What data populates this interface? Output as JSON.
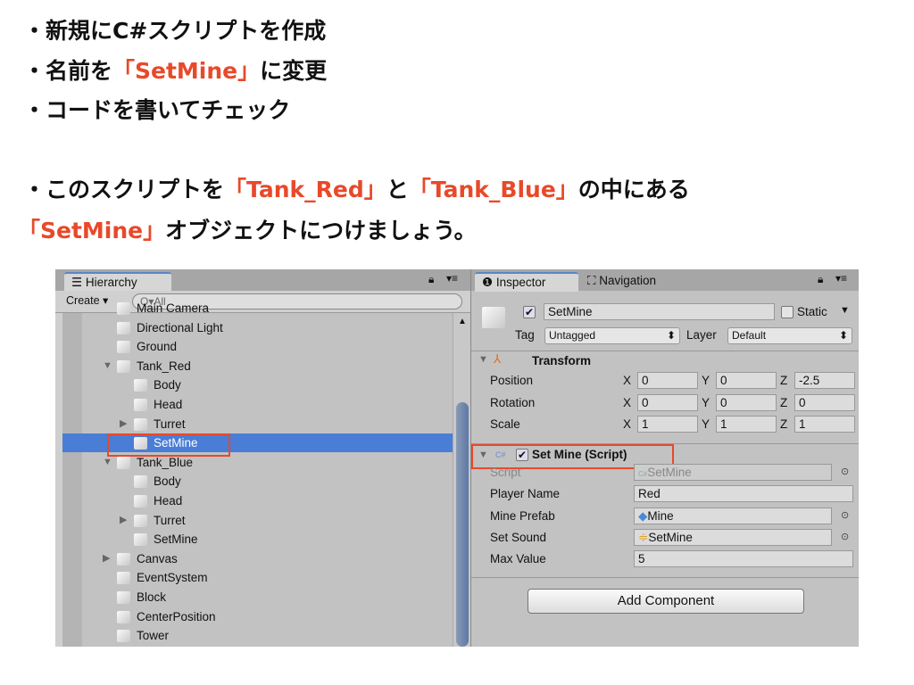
{
  "slide": {
    "line1": "・新規にC#スクリプトを作成",
    "line2_pre": "・名前を",
    "line2_hl": "「SetMine」",
    "line2_post": "に変更",
    "line3": "・コードを書いてチェック",
    "line4_pre": "・このスクリプトを",
    "line4_hl1": "「Tank_Red」",
    "line4_mid": "と",
    "line4_hl2": "「Tank_Blue」",
    "line4_post": "の中にある",
    "line5_hl": "「SetMine」",
    "line5_post": "オブジェクトにつけましょう。",
    "accent_color": "#e8492a"
  },
  "hierarchy": {
    "tab": "Hierarchy",
    "create": "Create ▾",
    "search_placeholder": "Q▾All",
    "items": [
      {
        "label": "Main Camera",
        "level": 0
      },
      {
        "label": "Directional Light",
        "level": 0
      },
      {
        "label": "Ground",
        "level": 0
      },
      {
        "label": "Tank_Red",
        "level": 0,
        "expanded": true
      },
      {
        "label": "Body",
        "level": 1
      },
      {
        "label": "Head",
        "level": 1
      },
      {
        "label": "Turret",
        "level": 1,
        "collapsed": true
      },
      {
        "label": "SetMine",
        "level": 1,
        "selected": true
      },
      {
        "label": "Tank_Blue",
        "level": 0,
        "expanded": true
      },
      {
        "label": "Body",
        "level": 1
      },
      {
        "label": "Head",
        "level": 1
      },
      {
        "label": "Turret",
        "level": 1,
        "collapsed": true
      },
      {
        "label": "SetMine",
        "level": 1
      },
      {
        "label": "Canvas",
        "level": 0,
        "collapsed": true
      },
      {
        "label": "EventSystem",
        "level": 0
      },
      {
        "label": "Block",
        "level": 0
      },
      {
        "label": "CenterPosition",
        "level": 0
      },
      {
        "label": "Tower",
        "level": 0
      }
    ]
  },
  "inspector": {
    "tab": "Inspector",
    "tab2": "Navigation",
    "name": "SetMine",
    "static": "Static",
    "tag_label": "Tag",
    "tag": "Untagged",
    "layer_label": "Layer",
    "layer": "Default",
    "transform": {
      "title": "Transform",
      "rows": [
        {
          "label": "Position",
          "x": "0",
          "y": "0",
          "z": "-2.5"
        },
        {
          "label": "Rotation",
          "x": "0",
          "y": "0",
          "z": "0"
        },
        {
          "label": "Scale",
          "x": "1",
          "y": "1",
          "z": "1"
        }
      ]
    },
    "script": {
      "title": "Set Mine (Script)",
      "cs": "C#",
      "fields": [
        {
          "label": "Script",
          "value": "SetMine"
        },
        {
          "label": "Player Name",
          "value": "Red"
        },
        {
          "label": "Mine Prefab",
          "value": "Mine"
        },
        {
          "label": "Set Sound",
          "value": "SetMine"
        },
        {
          "label": "Max Value",
          "value": "5"
        }
      ]
    },
    "add_component": "Add Component"
  }
}
